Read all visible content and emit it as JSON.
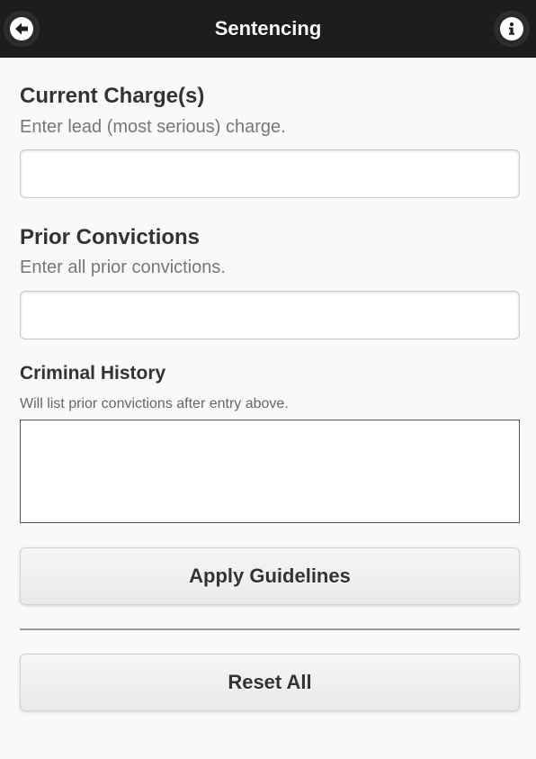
{
  "header": {
    "title": "Sentencing",
    "back_icon": "arrow-left-icon",
    "info_icon": "info-icon"
  },
  "current_charges": {
    "title": "Current Charge(s)",
    "subtitle": "Enter lead (most serious) charge.",
    "value": "",
    "placeholder": ""
  },
  "prior_convictions": {
    "title": "Prior Convictions",
    "subtitle": "Enter all prior convictions.",
    "value": "",
    "placeholder": ""
  },
  "criminal_history": {
    "title": "Criminal History",
    "subtitle": "Will list prior convictions after entry above.",
    "value": ""
  },
  "buttons": {
    "apply_label": "Apply Guidelines",
    "reset_label": "Reset All"
  },
  "colors": {
    "header_bg": "#1d1d1d",
    "page_bg": "#f9f9f9"
  }
}
